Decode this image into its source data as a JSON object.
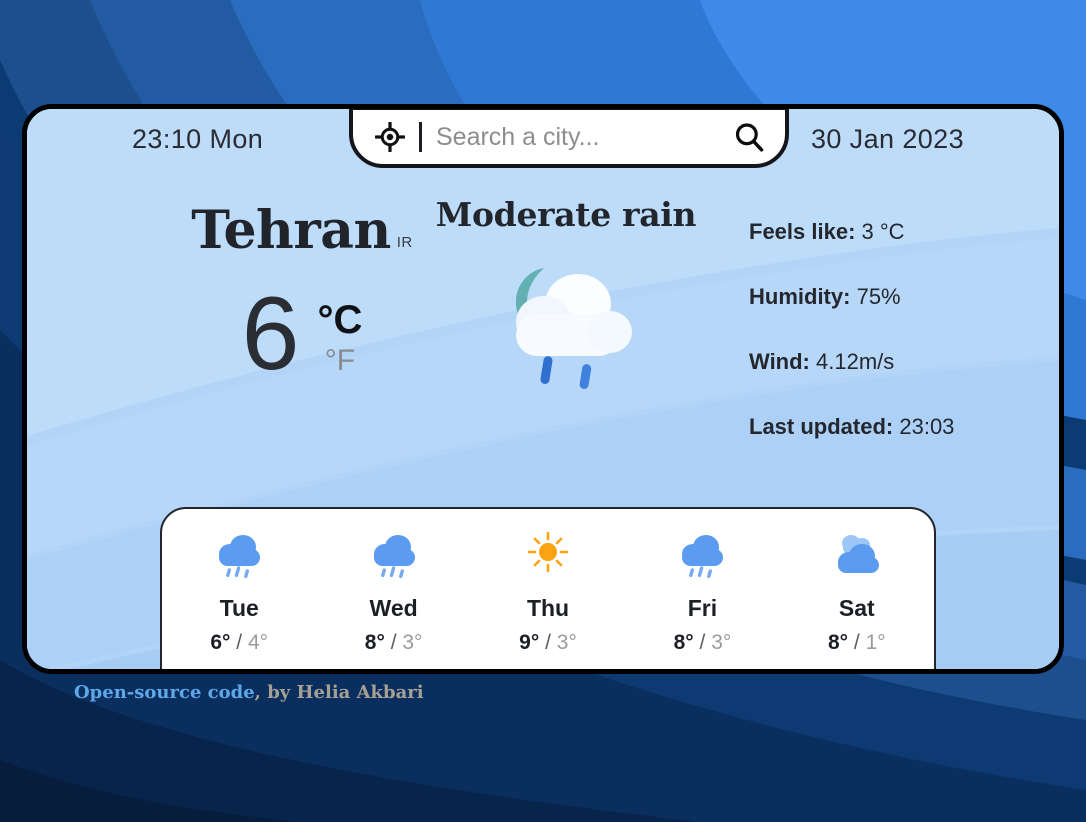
{
  "header": {
    "time": "23:10 Mon",
    "date": "30 Jan 2023",
    "location_icon": "crosshair-location-icon",
    "search_icon": "magnifier-icon"
  },
  "search": {
    "value": "",
    "placeholder": "Search a city..."
  },
  "current": {
    "city": "Tehran",
    "country_code": "IR",
    "temperature": "6",
    "unit_celsius": "°C",
    "unit_fahrenheit": "°F",
    "active_unit": "celsius",
    "condition": "Moderate rain",
    "condition_icon": "moon-cloud-rain-icon"
  },
  "details": [
    {
      "label": "Feels like:",
      "value": "3 °C"
    },
    {
      "label": "Humidity:",
      "value": "75%"
    },
    {
      "label": "Wind:",
      "value": "4.12m/s"
    },
    {
      "label": "Last updated:",
      "value": "23:03"
    }
  ],
  "forecast": [
    {
      "day": "Tue",
      "icon": "cloud-rain-icon",
      "high": "6°",
      "sep": "/",
      "low": "4°"
    },
    {
      "day": "Wed",
      "icon": "cloud-rain-icon",
      "high": "8°",
      "sep": "/",
      "low": "3°"
    },
    {
      "day": "Thu",
      "icon": "sun-icon",
      "high": "9°",
      "sep": "/",
      "low": "3°"
    },
    {
      "day": "Fri",
      "icon": "cloud-rain-icon",
      "high": "8°",
      "sep": "/",
      "low": "3°"
    },
    {
      "day": "Sat",
      "icon": "partly-cloudy-icon",
      "high": "8°",
      "sep": "/",
      "low": "1°"
    }
  ],
  "footer": {
    "link_text": "Open-source code",
    "byline": ", by Helia Akbari"
  },
  "colors": {
    "accent_blue": "#5b9bf0",
    "link_blue": "#5fa8e8",
    "byline_tan": "#a5a093",
    "card_bg": "#b2d4f7",
    "page_bg": "#0a2d5e",
    "sun_yellow": "#fca311",
    "moon_teal": "#6cb8b8",
    "rain_blue": "#2f6fd0"
  }
}
